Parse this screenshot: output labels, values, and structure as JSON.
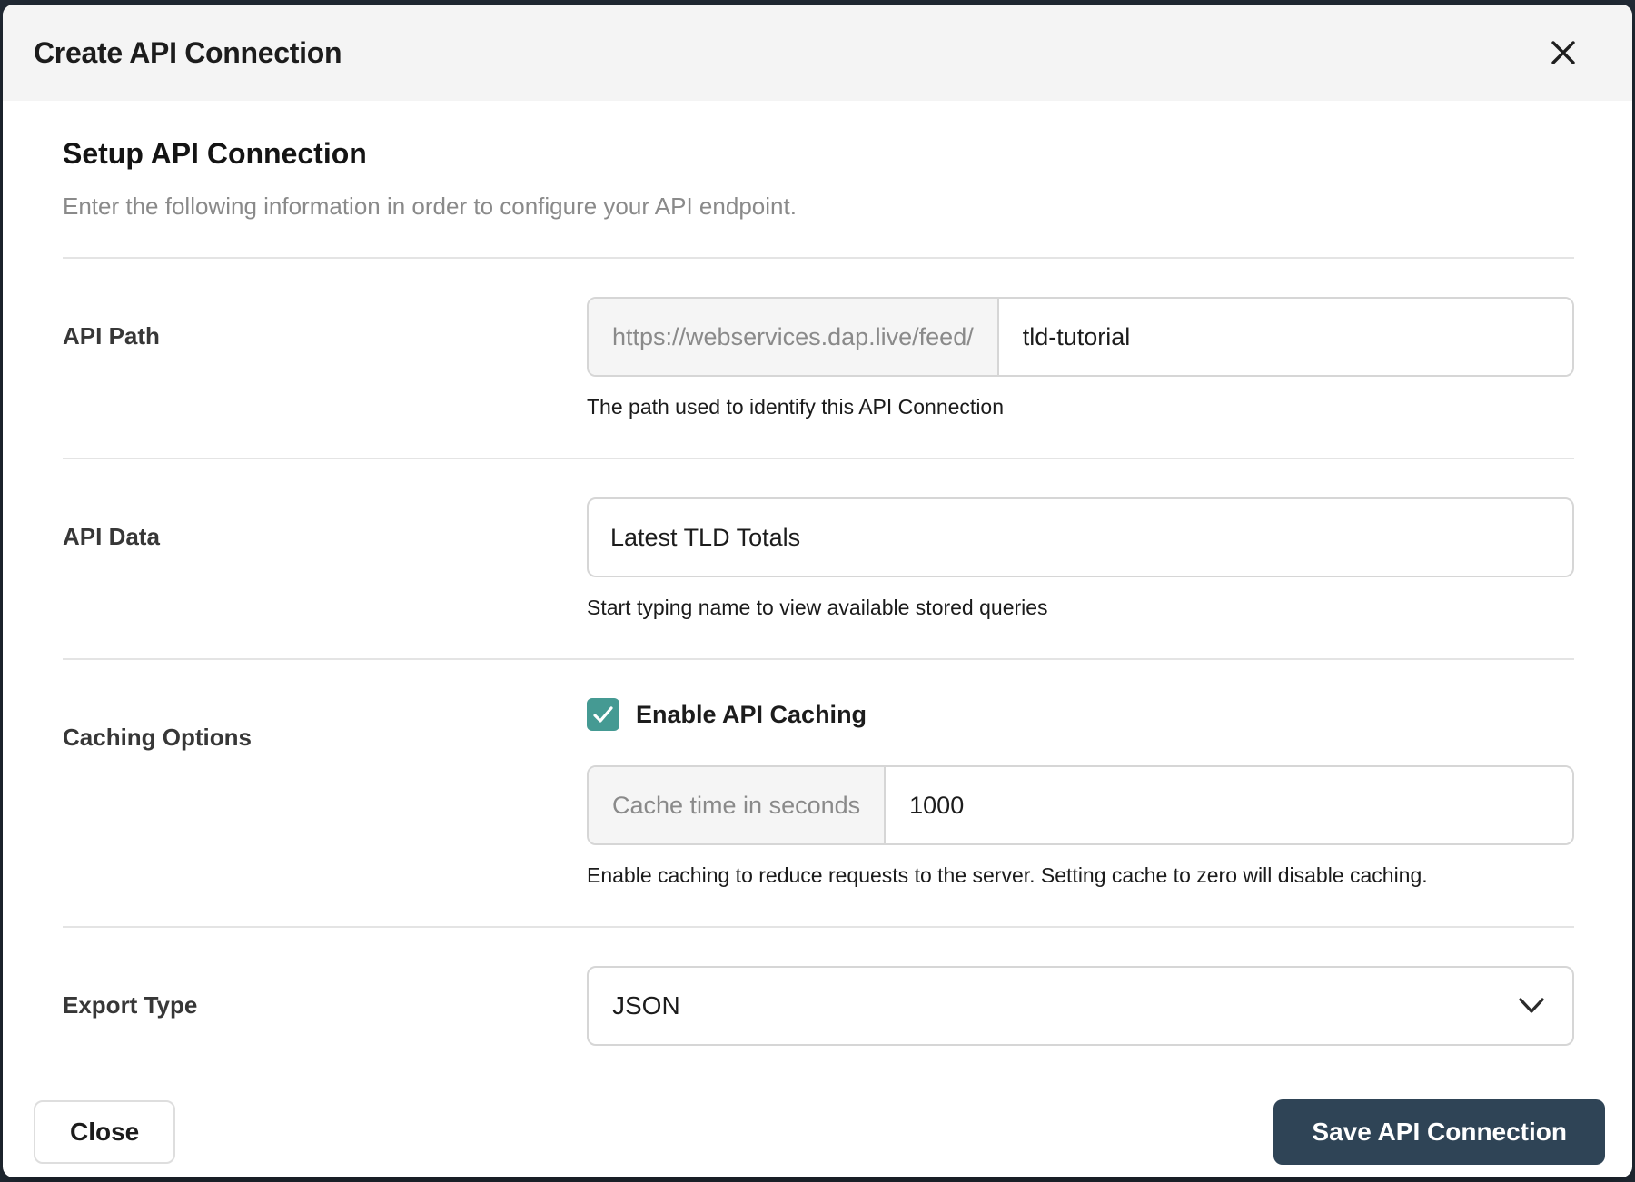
{
  "modal": {
    "title": "Create API Connection"
  },
  "form": {
    "heading": "Setup API Connection",
    "description": "Enter the following information in order to configure your API endpoint.",
    "api_path": {
      "label": "API Path",
      "prefix": "https://webservices.dap.live/feed/",
      "value": "tld-tutorial",
      "help": "The path used to identify this API Connection"
    },
    "api_data": {
      "label": "API Data",
      "value": "Latest TLD Totals",
      "help": "Start typing name to view available stored queries"
    },
    "caching": {
      "label": "Caching Options",
      "checkbox_label": "Enable API Caching",
      "checked": true,
      "prefix": "Cache time in seconds",
      "value": "1000",
      "help": "Enable caching to reduce requests to the server. Setting cache to zero will disable caching."
    },
    "export": {
      "label": "Export Type",
      "value": "JSON"
    }
  },
  "footer": {
    "close_label": "Close",
    "save_label": "Save API Connection"
  },
  "colors": {
    "accent_teal": "#459a93",
    "primary_button": "#2f4456",
    "backdrop": "#232c37",
    "header_bg": "#f4f4f4",
    "input_border": "#d6d6d6"
  }
}
